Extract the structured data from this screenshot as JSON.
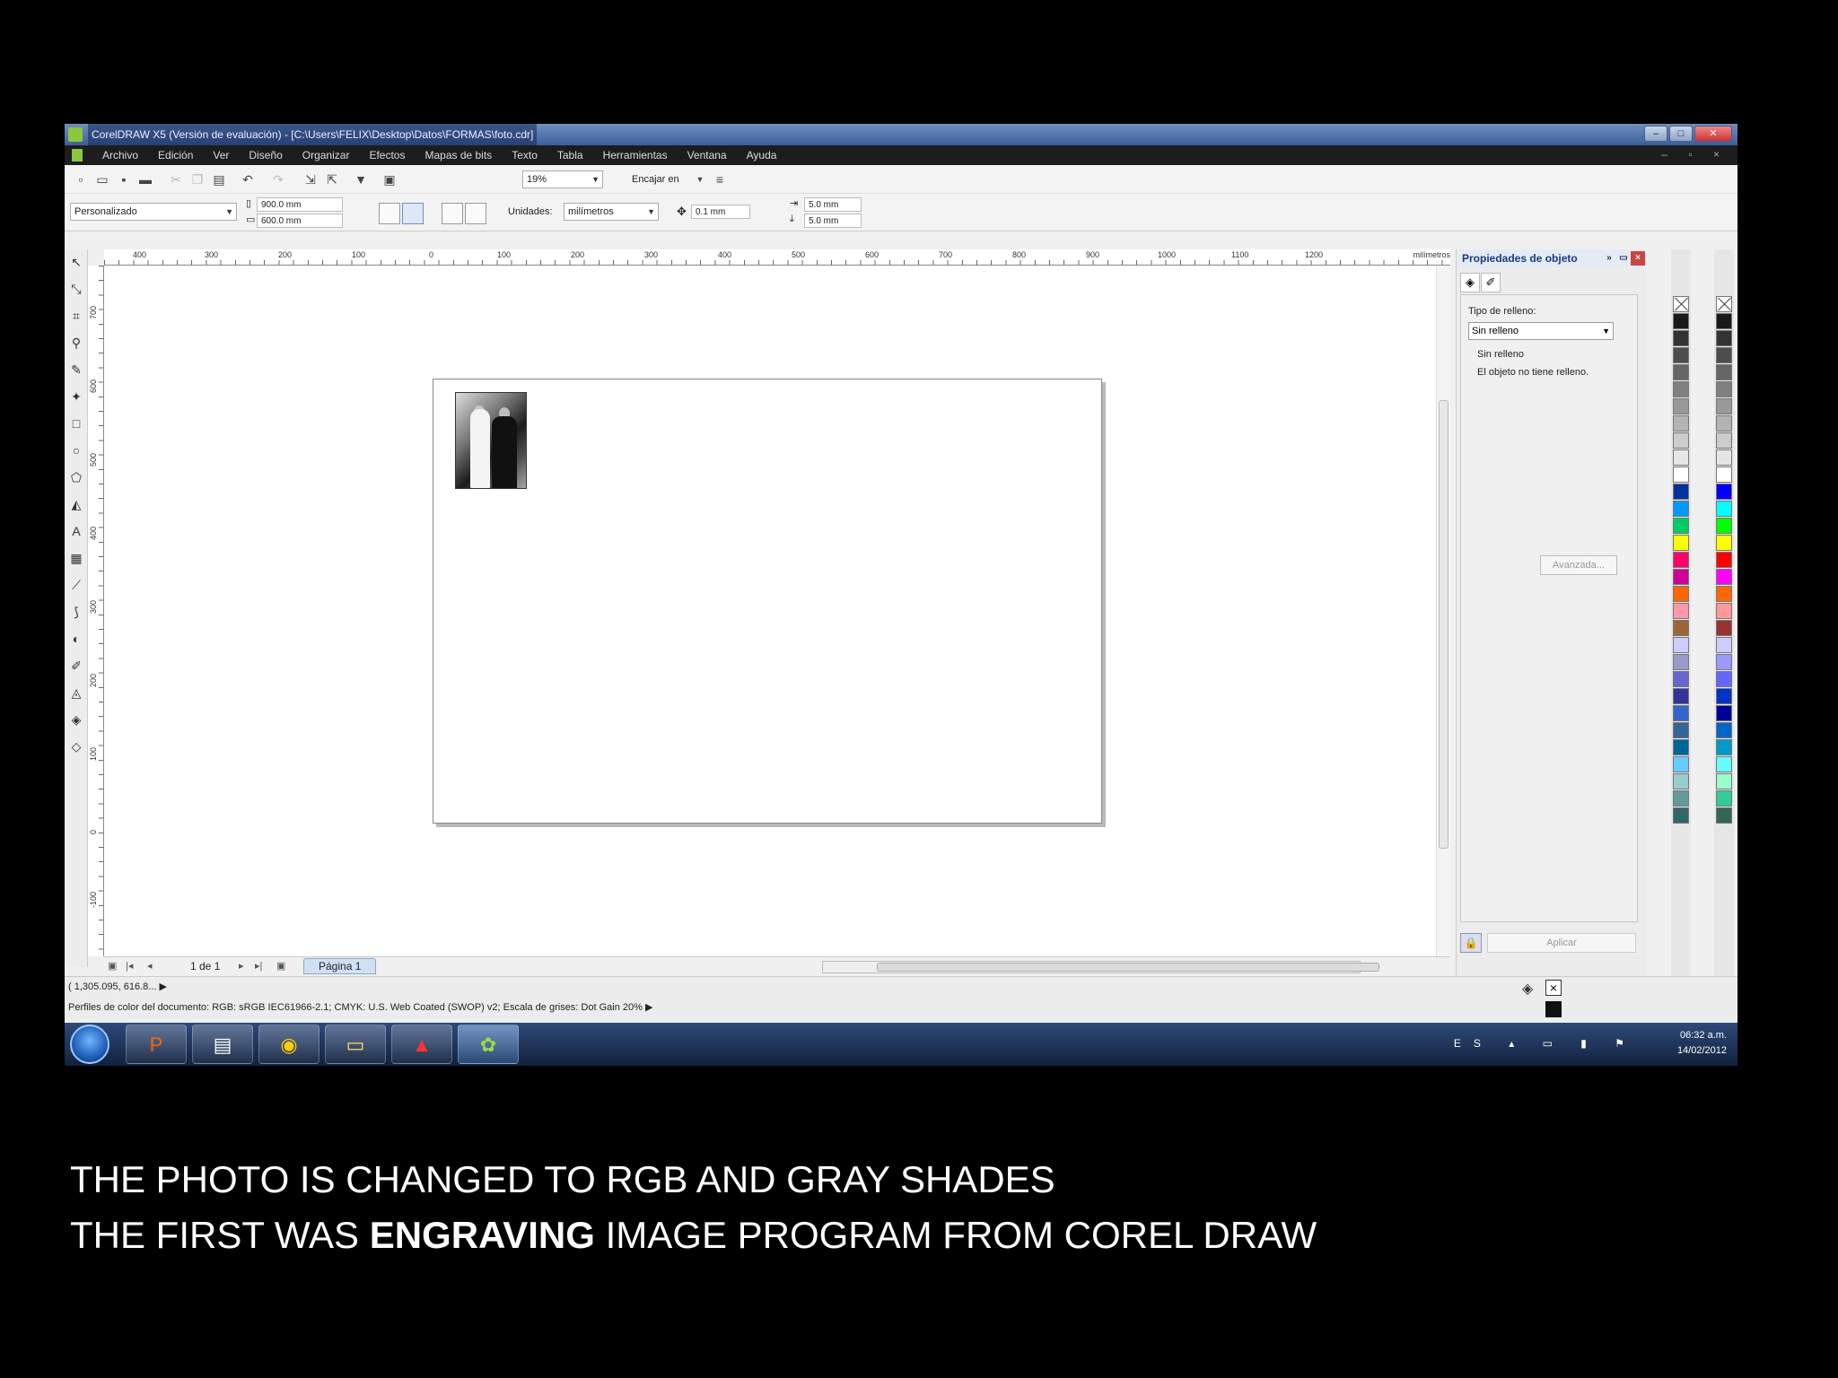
{
  "window": {
    "title": "CorelDRAW X5 (Versión de evaluación) - [C:\\Users\\FELIX\\Desktop\\Datos\\FORMAS\\foto.cdr]"
  },
  "menu": [
    "Archivo",
    "Edición",
    "Ver",
    "Diseño",
    "Organizar",
    "Efectos",
    "Mapas de bits",
    "Texto",
    "Tabla",
    "Herramientas",
    "Ventana",
    "Ayuda"
  ],
  "toolbar": {
    "zoom": "19%",
    "snap": "Encajar en"
  },
  "property_bar": {
    "preset": "Personalizado",
    "width": "900.0 mm",
    "height": "600.0 mm",
    "units_label": "Unidades:",
    "units_value": "milímetros",
    "nudge": "0.1 mm",
    "dup_x": "5.0 mm",
    "dup_y": "5.0 mm"
  },
  "ruler": {
    "h_labels": [
      "400",
      "300",
      "200",
      "100",
      "0",
      "100",
      "200",
      "300",
      "400",
      "500",
      "600",
      "700",
      "800",
      "900",
      "1000",
      "1100",
      "1200"
    ],
    "unit": "milímetros",
    "v_labels": [
      "700",
      "600",
      "500",
      "400",
      "300",
      "200",
      "100",
      "0",
      "-100"
    ]
  },
  "page_nav": {
    "count": "1 de 1",
    "tab": "Página 1"
  },
  "docker": {
    "title": "Propiedades de objeto",
    "fill_type_label": "Tipo de relleno:",
    "fill_type_value": "Sin relleno",
    "fill_none_title": "Sin relleno",
    "fill_none_desc": "El objeto no tiene relleno.",
    "advanced": "Avanzada...",
    "apply": "Aplicar"
  },
  "status": {
    "coords": "( 1,305.095, 616.8... ▶",
    "color_profile": "Perfiles de color del documento: RGB: sRGB IEC61966-2.1; CMYK: U.S. Web Coated (SWOP) v2; Escala de grises: Dot Gain 20% ▶"
  },
  "palette_colors": {
    "left": [
      "#1a1a1a",
      "#333333",
      "#4d4d4d",
      "#666666",
      "#808080",
      "#999999",
      "#b3b3b3",
      "#cccccc",
      "#e6e6e6",
      "#ffffff",
      "#003399",
      "#0099ff",
      "#00cc66",
      "#ffff00",
      "#ff0066",
      "#cc0099",
      "#ff6600",
      "#ff99aa",
      "#996633",
      "#ccccff",
      "#9999cc",
      "#6666cc",
      "#333399",
      "#3366cc",
      "#336699",
      "#006699",
      "#66ccff",
      "#99cccc",
      "#669999",
      "#336666"
    ],
    "right": [
      "#1a1a1a",
      "#333333",
      "#4d4d4d",
      "#666666",
      "#808080",
      "#999999",
      "#b3b3b3",
      "#cccccc",
      "#e6e6e6",
      "#ffffff",
      "#0000ff",
      "#00ffff",
      "#00ff00",
      "#ffff00",
      "#ff0000",
      "#ff00ff",
      "#ff6600",
      "#ff9999",
      "#993333",
      "#ccccff",
      "#9999ff",
      "#6666ff",
      "#0033cc",
      "#000099",
      "#0066cc",
      "#0099cc",
      "#66ffff",
      "#99ffcc",
      "#33cc99",
      "#336655"
    ]
  },
  "tray": {
    "lang": "ES",
    "time": "06:32 a.m.",
    "date": "14/02/2012"
  },
  "caption": {
    "line1": "THE PHOTO IS CHANGED TO RGB AND GRAY SHADES",
    "line2_pre": "THE FIRST WAS ",
    "line2_bold": "ENGRAVING",
    "line2_post": " IMAGE PROGRAM FROM COREL DRAW"
  }
}
